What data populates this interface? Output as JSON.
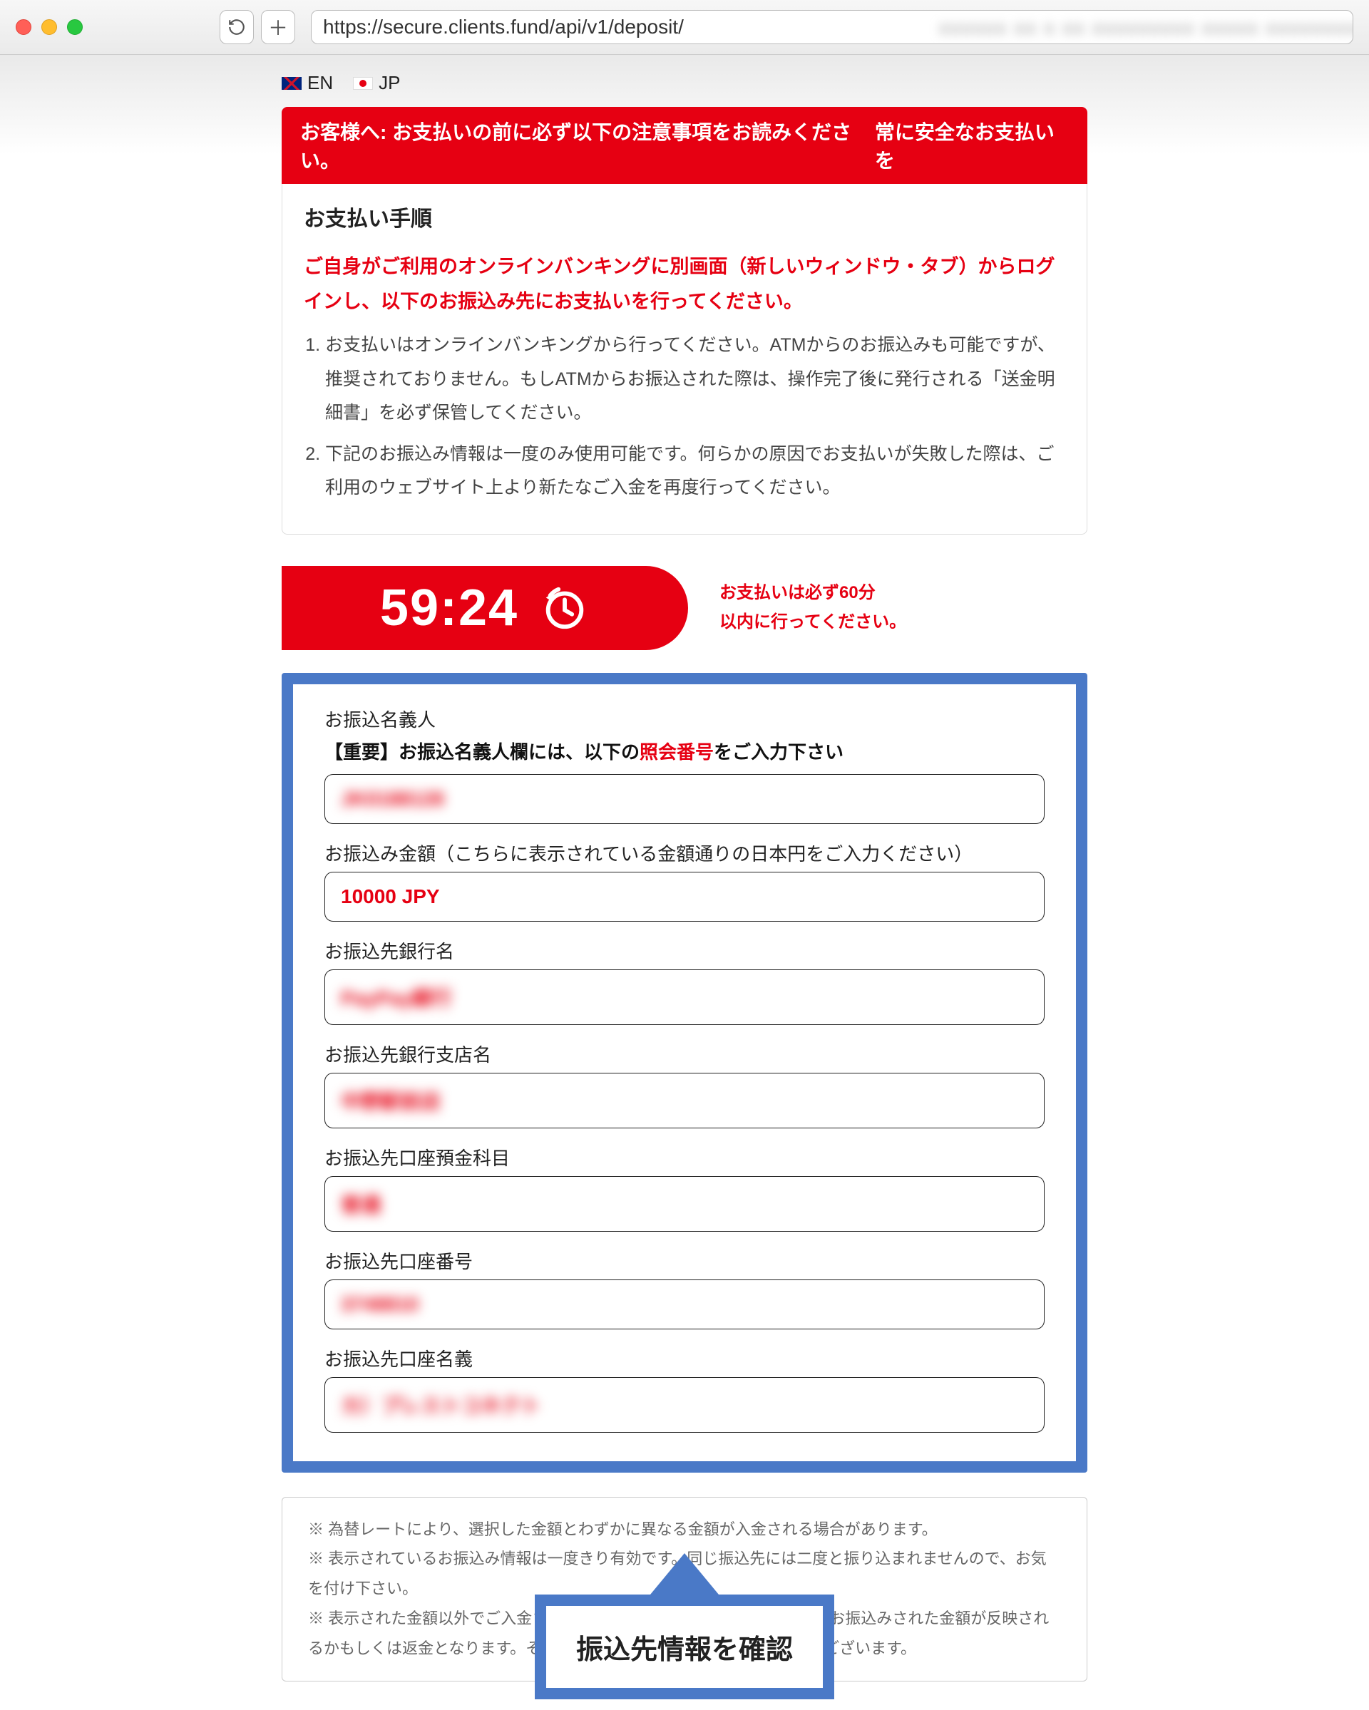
{
  "browser": {
    "url": "https://secure.clients.fund/api/v1/deposit/"
  },
  "lang": {
    "en": "EN",
    "jp": "JP"
  },
  "banner": {
    "left": "お客様へ: お支払いの前に必ず以下の注意事項をお読みください。",
    "right": "常に安全なお支払いを"
  },
  "procedure": {
    "title": "お支払い手順",
    "highlight": "ご自身がご利用のオンラインバンキングに別画面（新しいウィンドウ・タブ）からログインし、以下のお振込み先にお支払いを行ってください。",
    "items": [
      "お支払いはオンラインバンキングから行ってください。ATMからのお振込みも可能ですが、推奨されておりません。もしATMからお振込された際は、操作完了後に発行される「送金明細書」を必ず保管してください。",
      "下記のお振込み情報は一度のみ使用可能です。何らかの原因でお支払いが失敗した際は、ご利用のウェブサイト上より新たなご入金を再度行ってください。"
    ]
  },
  "timer": {
    "value": "59:24",
    "note1": "お支払いは必ず60分",
    "note2": "以内に行ってください。"
  },
  "form": {
    "sender_name": {
      "label": "お振込名義人",
      "sub_prefix": "【重要】お振込名義人欄には、以下の",
      "sub_emph": "照会番号",
      "sub_suffix": "をご入力下さい",
      "value": "JK0188128"
    },
    "amount": {
      "label": "お振込み金額（こちらに表示されている金額通りの日本円をご入力ください）",
      "value": "10000 JPY"
    },
    "bank_name": {
      "label": "お振込先銀行名",
      "value": "PayPay銀行"
    },
    "branch_name": {
      "label": "お振込先銀行支店名",
      "value": "中野駅前店"
    },
    "account_type": {
      "label": "お振込先口座預金科目",
      "value": "普通"
    },
    "account_number": {
      "label": "お振込先口座番号",
      "value": "3748810"
    },
    "account_holder": {
      "label": "お振込先口座名義",
      "value": "カ）プレストコネクト"
    }
  },
  "notes": {
    "n1": "※ 為替レートにより、選択した金額とわずかに異なる金額が入金される場合があります。",
    "n2": "※ 表示されているお振込み情報は一度きり有効です。同じ振込先には二度と振り込まれませんので、お気を付け下さい。",
    "n3": "※ 表示された金額以外でご入金された場合、処理に時間がかかり、実際にお振込みされた金額が反映されるかもしくは返金となります。その際には銀行手数料が別途かかる場合がございます。"
  },
  "callout": {
    "text": "振込先情報を確認"
  }
}
